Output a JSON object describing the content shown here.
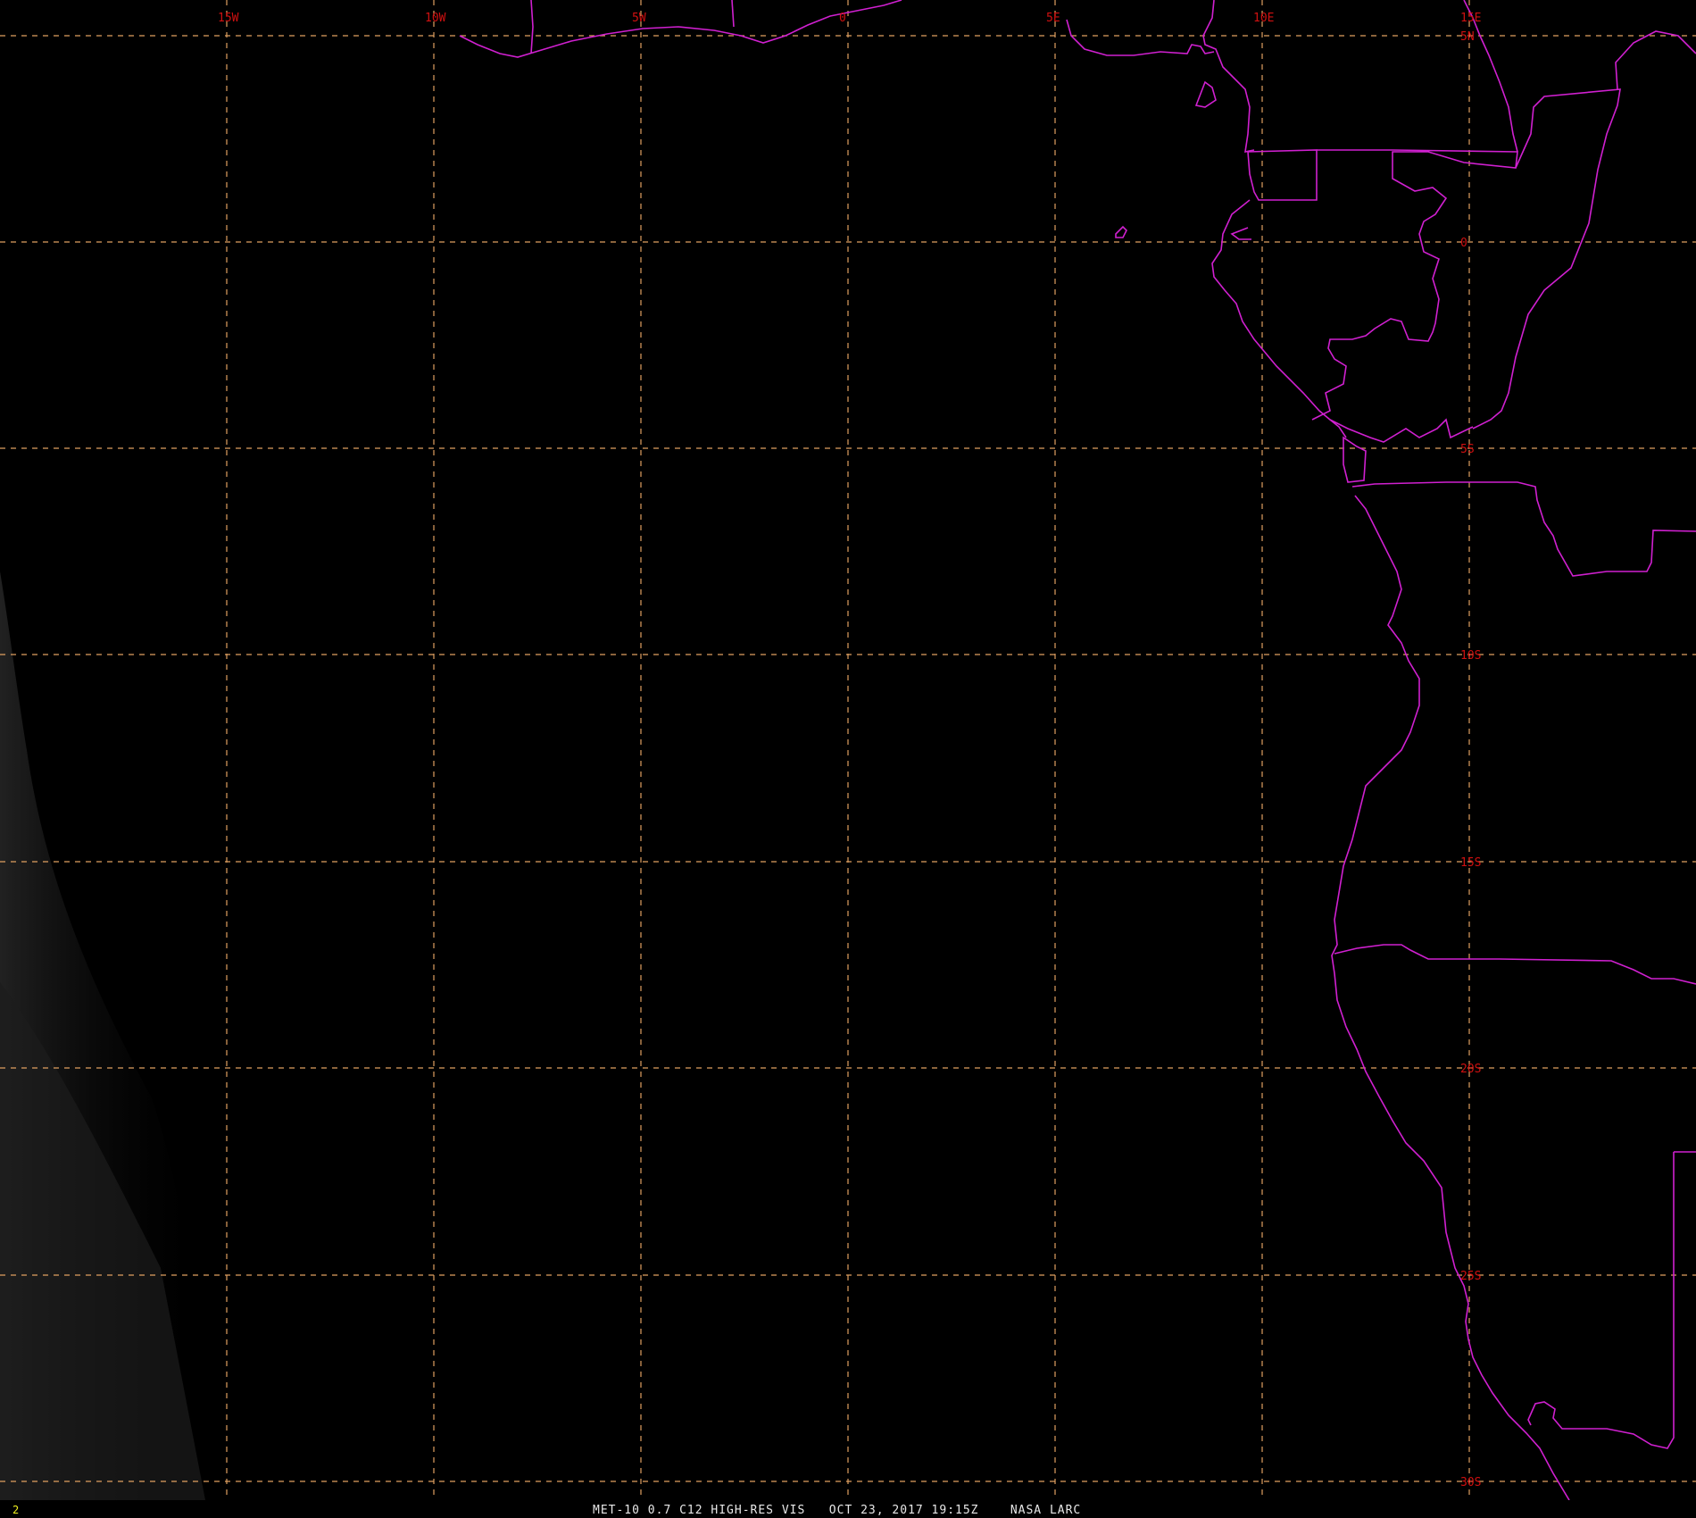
{
  "map": {
    "colors": {
      "background": "#000000",
      "grid": "#e0a060",
      "boundaries": "#d020d0",
      "labels": "#d01010",
      "frame_number": "#f0f020",
      "caption": "#e8e8e8"
    },
    "longitude_labels": [
      "15W",
      "10W",
      "5W",
      "0",
      "5E",
      "10E",
      "15E"
    ],
    "latitude_labels": [
      "5N",
      "0",
      "5S",
      "10S",
      "15S",
      "20S",
      "25S",
      "30S"
    ],
    "grid_spacing_degrees": 5,
    "features": [
      "west-africa-coastline",
      "gulf-of-guinea",
      "gabon",
      "congo",
      "angola",
      "namibia",
      "south-africa",
      "bioko-island"
    ],
    "cloud_region": "southwest-corner"
  },
  "status": {
    "frame_number": "2",
    "caption": "MET-10 0.7 C12 HIGH-RES VIS   OCT 23, 2017 19:15Z    NASA LARC"
  }
}
